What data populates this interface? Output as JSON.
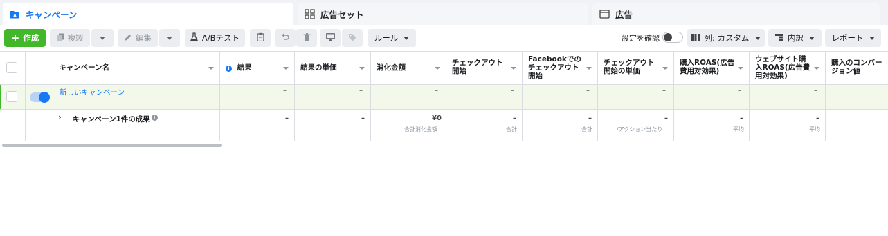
{
  "tabs": [
    {
      "label": "キャンペーン",
      "icon": "folder-icon"
    },
    {
      "label": "広告セット",
      "icon": "grid-icon"
    },
    {
      "label": "広告",
      "icon": "ad-icon"
    }
  ],
  "toolbar": {
    "create": "作成",
    "duplicate": "複製",
    "edit": "編集",
    "ab_test": "A/Bテスト",
    "rules": "ルール",
    "settings_check": "設定を確認",
    "columns": "列: カスタム",
    "breakdown": "内訳",
    "reports": "レポート"
  },
  "table": {
    "headers": [
      "キャンペーン名",
      "結果",
      "結果の単価",
      "消化金額",
      "チェックアウト開始",
      "Facebookでのチェックアウト開始",
      "チェックアウト開始の単価",
      "購入ROAS(広告費用対効果)",
      "ウェブサイト購入ROAS(広告費用対効果)",
      "購入のコンバージョン値"
    ],
    "header_lines": {
      "h4": [
        "チェックアウト",
        "開始"
      ],
      "h5": [
        "Facebookでの",
        "チェックアウト",
        "開始"
      ],
      "h6": [
        "チェックアウト",
        "開始の単価"
      ],
      "h7": [
        "購入ROAS(広告",
        "費用対効果)"
      ],
      "h8": [
        "ウェブサイト購",
        "入ROAS(広告費",
        "用対効果)"
      ],
      "h9": [
        "購入のコンバー",
        "ジョン値"
      ]
    },
    "row": {
      "name": "新しいキャンペーン",
      "dash": "–"
    },
    "summary": {
      "label": "キャンペーン1件の成果",
      "dash": "–",
      "spend": "¥0",
      "spend_sub": "合計消化金額",
      "total": "合計",
      "per_action": "/アクション当たり",
      "average": "平均"
    }
  },
  "colors": {
    "accent": "#1877f2",
    "create": "#42b72a",
    "row_highlight": "#f3f9ea"
  }
}
